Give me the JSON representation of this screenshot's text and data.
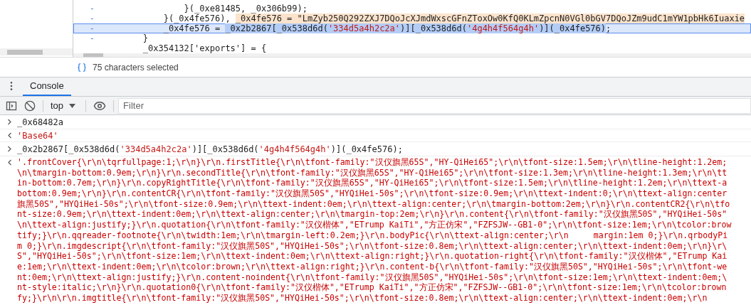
{
  "editor": {
    "lines": [
      {
        "marker": "-",
        "selected": false,
        "segments": [
          {
            "kind": "code",
            "highlighted": false,
            "text": "                }(_0xe81485, _0x306b99);"
          }
        ]
      },
      {
        "marker": "-",
        "selected": false,
        "segments": [
          {
            "kind": "code",
            "highlighted": false,
            "text": "            }(_0x4fe576), "
          },
          {
            "kind": "code",
            "highlighted": true,
            "text": "_0x4fe576 = \"LmZyb250Q292ZXJ7DQoJcXJmdWxscGFnZToxOw0KfQ0KLmZpcnN0VGl0bGV7DQoJZm9udC1mYW1pbHk6Iuaxie"
          }
        ]
      },
      {
        "marker": "-",
        "selected": true,
        "segments": [
          {
            "kind": "code",
            "selected": false,
            "text": "            _0x4fe576 = "
          },
          {
            "kind": "code",
            "selected": true,
            "text": "_0x2b2867[_0x538d6d("
          },
          {
            "kind": "string",
            "selected": true,
            "text": "'334d5a4h2c2a'"
          },
          {
            "kind": "code",
            "selected": true,
            "text": ")][_0x538d6d("
          },
          {
            "kind": "string",
            "selected": true,
            "text": "'4g4h4f564g4h'"
          },
          {
            "kind": "code",
            "selected": true,
            "text": ")](_0x4fe576)"
          },
          {
            "kind": "code",
            "selected": false,
            "text": ";"
          }
        ]
      },
      {
        "marker": "-",
        "selected": false,
        "segments": [
          {
            "kind": "code",
            "text": "        }"
          }
        ]
      },
      {
        "selected": false,
        "segments": [
          {
            "kind": "code",
            "text": "        _0x354132['exports'] = {"
          }
        ]
      }
    ]
  },
  "status": "75 characters selected",
  "tabs": [
    {
      "label": "Console",
      "selected": true
    }
  ],
  "toolbar": {
    "context": "top",
    "filter_placeholder": "Filter"
  },
  "console": [
    {
      "kind": "input",
      "segments": [
        {
          "kind": "code",
          "text": "_0x68482a"
        }
      ]
    },
    {
      "kind": "result",
      "segments": [
        {
          "kind": "string",
          "text": "'Base64'"
        }
      ]
    },
    {
      "kind": "input",
      "segments": [
        {
          "kind": "code",
          "text": "_0x2b2867[_0x538d6d("
        },
        {
          "kind": "string",
          "text": "'334d5a4h2c2a'"
        },
        {
          "kind": "code",
          "text": ")][_0x538d6d("
        },
        {
          "kind": "string",
          "text": "'4g4h4f564g4h'"
        },
        {
          "kind": "code",
          "text": ")](_0x4fe576);"
        }
      ]
    },
    {
      "kind": "output",
      "lines": [
        "'.frontCover{\\r\\n\\tqrfullpage:1;\\r\\n}\\r\\n.firstTitle{\\r\\n\\tfont-family:\"汉仪旗黑65S\",\"HY-QiHei65\";\\r\\n\\tfont-size:1.5em;\\r\\n\\tline-height:1.2em;",
        "\\n\\tmargin-bottom:0.9em;\\r\\n}\\r\\n.secondTitle{\\r\\n\\tfont-family:\"汉仪旗黑65S\",\"HY-QiHei65\";\\r\\n\\tfont-size:1.3em;\\r\\n\\tline-height:1.3em;\\r\\n\\tt",
        "in-bottom:0.7em;\\r\\n}\\r\\n.copyRightTitle{\\r\\n\\tfont-family:\"汉仪旗黑65S\",\"HY-QiHei65\";\\r\\n\\tfont-size:1.5em;\\r\\n\\tline-height:1.2em;\\r\\n\\ttext-a",
        "bottom:0.9em;\\r\\n}\\r\\n.contentCR{\\r\\n\\tfont-family:\"汉仪旗黑50S\",\"HYQiHei-50s\";\\r\\n\\tfont-size:0.9em;\\r\\n\\ttext-indent:0;\\r\\n\\ttext-align:center",
        "旗黑50S\",\"HYQiHei-50s\";\\r\\n\\tfont-size:0.9em;\\r\\n\\ttext-indent:0em;\\r\\n\\ttext-align:center;\\r\\n\\tmargin-bottom:2em;\\r\\n}\\r\\n.contentCR2{\\r\\n\\tfo",
        "nt-size:0.9em;\\r\\n\\ttext-indent:0em;\\r\\n\\ttext-align:center;\\r\\n\\tmargin-top:2em;\\r\\n}\\r\\n.content{\\r\\n\\tfont-family:\"汉仪旗黑50S\",\"HYQiHei-50s\"",
        "\\n\\ttext-align:justify;}\\r\\n.quotation{\\r\\n\\tfont-family:\"汉仪楷体\",\"ETrump KaiTi\",\"方正仿宋\",\"FZFSJW--GB1-0\";\\r\\n\\tfont-size:1em;\\r\\n\\tcolor:brow",
        "tify;}\\r\\n.qqreader-footnote{\\r\\n\\twidth:1em;\\r\\n\\tmargin-left:0.2em;}\\r\\n.bodyPic{\\r\\n\\ttext-align:center;\\r\\n     margin:1em 0;}\\r\\n.qrbodyPi",
        "m 0;}\\r\\n.imgdescript{\\r\\n\\tfont-family:\"汉仪旗黑50S\",\"HYQiHei-50s\";\\r\\n\\tfont-size:0.8em;\\r\\n\\ttext-align:center;\\r\\n\\ttext-indent:0em;\\r\\n}\\r\\",
        "S\",\"HYQiHei-50s\";\\r\\n\\tfont-size:1em;\\r\\n\\ttext-indent:0em;\\r\\n\\ttext-align:right;}\\r\\n.quotation-right{\\r\\n\\tfont-family:\"汉仪楷体\",\"ETrump Kai",
        "e:1em;\\r\\n\\ttext-indent:0em;\\r\\n\\tcolor:brown;\\r\\n\\ttext-align:right;}\\r\\n.content-b{\\r\\n\\tfont-family:\"汉仪旗黑50S\",\"HYQiHei-50s\";\\r\\n\\tfont-we",
        "nt:0em;\\r\\n\\ttext-align:justify;}\\r\\n.content-noindent{\\r\\n\\tfont-family:\"汉仪旗黑50S\",\"HYQiHei-50s\";\\r\\n\\tfont-size:1em;\\r\\n\\ttext-indent:0em;\\",
        "nt-style:italic;\\r\\n}\\r\\n.quotation0{\\r\\n\\tfont-family:\"汉仪楷体\",\"ETrump KaiTi\",\"方正仿宋\",\"FZFSJW--GB1-0\";\\r\\n\\tfont-size:1em;\\r\\n\\tcolor:brown",
        "fy;}\\r\\n\\r\\n.imgtitle{\\r\\n\\tfont-family:\"汉仪旗黑50S\",\"HYQiHei-50s\";\\r\\n\\tfont-size:0.8em;\\r\\n\\ttext-align:center;\\r\\n\\ttext-indent:0em;\\r\\n"
      ]
    }
  ]
}
